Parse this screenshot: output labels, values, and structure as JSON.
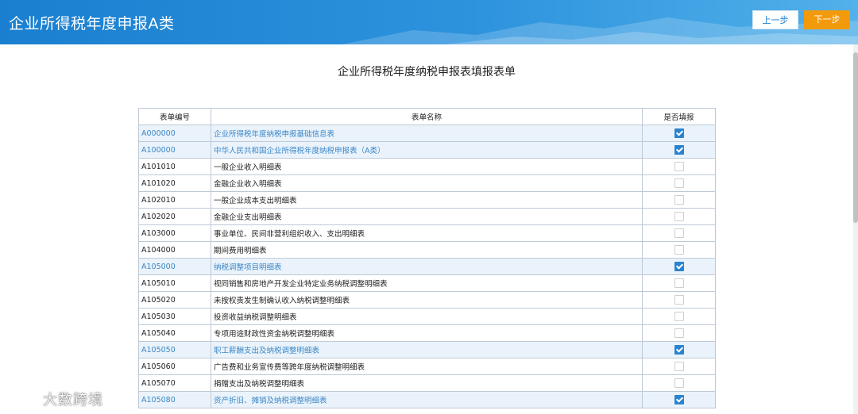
{
  "header": {
    "title": "企业所得税年度申报A类",
    "prev_label": "上一步",
    "next_label": "下一步"
  },
  "page_title": "企业所得税年度纳税申报表填报表单",
  "table": {
    "columns": [
      "表单编号",
      "表单名称",
      "是否填报"
    ],
    "rows": [
      {
        "code": "A000000",
        "name": "企业所得税年度纳税申报基础信息表",
        "checked": true
      },
      {
        "code": "A100000",
        "name": "中华人民共和国企业所得税年度纳税申报表（A类）",
        "checked": true
      },
      {
        "code": "A101010",
        "name": "一般企业收入明细表",
        "checked": false
      },
      {
        "code": "A101020",
        "name": "金融企业收入明细表",
        "checked": false
      },
      {
        "code": "A102010",
        "name": "一般企业成本支出明细表",
        "checked": false
      },
      {
        "code": "A102020",
        "name": "金融企业支出明细表",
        "checked": false
      },
      {
        "code": "A103000",
        "name": "事业单位、民间非营利组织收入、支出明细表",
        "checked": false
      },
      {
        "code": "A104000",
        "name": "期间费用明细表",
        "checked": false
      },
      {
        "code": "A105000",
        "name": "纳税调整项目明细表",
        "checked": true
      },
      {
        "code": "A105010",
        "name": "视同销售和房地产开发企业特定业务纳税调整明细表",
        "checked": false
      },
      {
        "code": "A105020",
        "name": "未按权责发生制确认收入纳税调整明细表",
        "checked": false
      },
      {
        "code": "A105030",
        "name": "投资收益纳税调整明细表",
        "checked": false
      },
      {
        "code": "A105040",
        "name": "专项用途财政性资金纳税调整明细表",
        "checked": false
      },
      {
        "code": "A105050",
        "name": "职工薪酬支出及纳税调整明细表",
        "checked": true
      },
      {
        "code": "A105060",
        "name": "广告费和业务宣传费等跨年度纳税调整明细表",
        "checked": false
      },
      {
        "code": "A105070",
        "name": "捐赠支出及纳税调整明细表",
        "checked": false
      },
      {
        "code": "A105080",
        "name": "资产折旧、摊销及纳税调整明细表",
        "checked": true
      }
    ]
  },
  "watermark": "大数跨境",
  "colors": {
    "header_blue": "#1a7fd0",
    "next_button_orange": "#f29a0c",
    "checked_blue": "#2a83cf",
    "highlight_row": "#eaf3fb"
  }
}
